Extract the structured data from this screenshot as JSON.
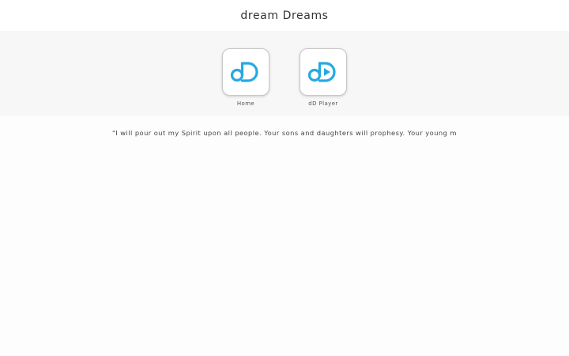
{
  "header": {
    "title": "dream Dreams"
  },
  "apps": [
    {
      "label": "Home",
      "icon": "dd-logo-icon"
    },
    {
      "label": "dD Player",
      "icon": "dd-player-logo-icon"
    }
  ],
  "quote": {
    "text": "\"I will pour out my Spirit upon all people. Your sons and daughters will prophesy. Your young m"
  },
  "colors": {
    "brand": "#27a9e1",
    "band_bg": "#f7f7f7"
  }
}
